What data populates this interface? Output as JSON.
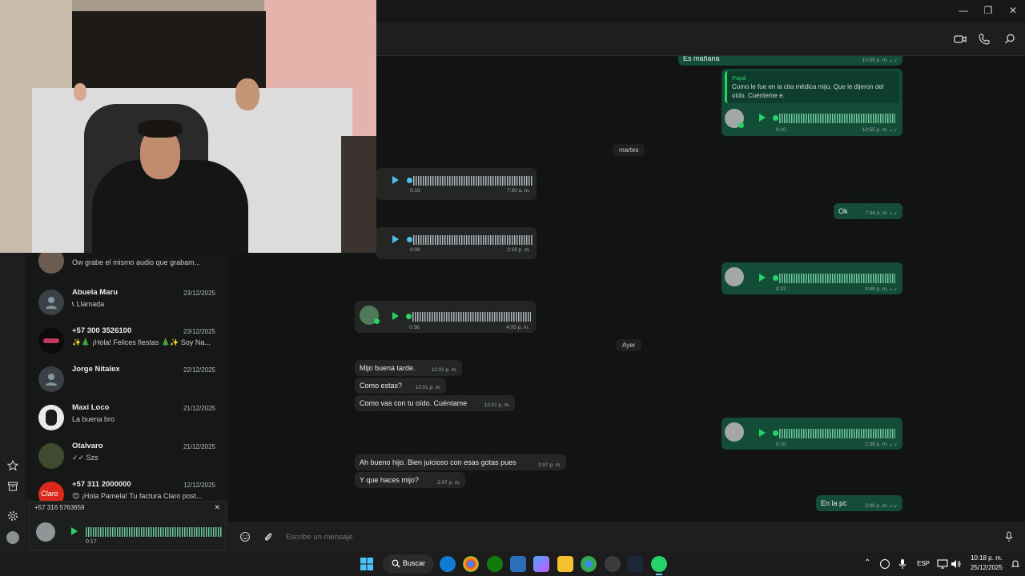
{
  "window": {
    "minimize": "—",
    "maximize": "❐",
    "close": "✕"
  },
  "chat_list": [
    {
      "name": "",
      "date": "",
      "preview": "Ow grabe el mismo audio que grabam..."
    },
    {
      "name": "Abuela Maru",
      "date": "23/12/2025",
      "preview": "Llamada"
    },
    {
      "name": "+57 300 3526100",
      "date": "23/12/2025",
      "preview": "✨🎄 ¡Hola! Felices fiestas 🎄✨ Soy Na..."
    },
    {
      "name": "Jorge Nitalex",
      "date": "22/12/2025",
      "preview": ""
    },
    {
      "name": "Maxi Loco",
      "date": "21/12/2025",
      "preview": "La buena bro"
    },
    {
      "name": "Otalvaro",
      "date": "21/12/2025",
      "preview": "Szs"
    },
    {
      "name": "+57 311 2000000",
      "date": "12/12/2025",
      "preview": "😊 ¡Hola Pamela! Tu factura Claro post..."
    }
  ],
  "mini_player": {
    "number": "+57 316 5763659",
    "duration": "0:17",
    "close": "✕"
  },
  "messages": {
    "es_manana": {
      "text": "Es mañana",
      "time": "10:55 p. m."
    },
    "reply_quote": {
      "author": "Papá",
      "text": "Como le fue en la cita médica mijo. Que le dijeron del oído. Cuénteme e."
    },
    "voice_out_1": {
      "duration": "0:10",
      "time": "10:55 p. m."
    },
    "date_martes": "martes",
    "voice_in_1": {
      "duration": "0:16",
      "time": "7:30 a. m."
    },
    "ok": {
      "text": "Ok",
      "time": "7:34 a. m."
    },
    "voice_in_2": {
      "duration": "0:09",
      "time": "2:18 p. m."
    },
    "voice_out_2": {
      "duration": "0:37",
      "time": "3:48 p. m."
    },
    "voice_in_3": {
      "duration": "0:36",
      "time": "4:05 p. m."
    },
    "date_ayer": "Ayer",
    "m1": {
      "text": "Mijo buena tarde.",
      "time": "12:01 p. m."
    },
    "m2": {
      "text": "Como estas?",
      "time": "12:01 p. m."
    },
    "m3": {
      "text": "Como vas con tu oído. Cuéntame",
      "time": "12:01 p. m."
    },
    "voice_out_3": {
      "duration": "0:10",
      "time": "1:38 p. m."
    },
    "m4": {
      "text": "Ah bueno hijo. Bien juicioso con esas gotas pues",
      "time": "2:07 p. m."
    },
    "m5": {
      "text": "Y que haces mijo?",
      "time": "2:07 p. m."
    },
    "en_la_pc": {
      "text": "En la pc",
      "time": "2:36 p. m."
    }
  },
  "composer": {
    "placeholder": "Escribe un mensaje"
  },
  "taskbar": {
    "search": "Buscar",
    "lang": "ESP",
    "time": "10:18 p. m.",
    "date": "25/12/2025"
  },
  "colors": {
    "outgoing": "#144d37",
    "incoming": "#242626",
    "accent": "#25d366"
  }
}
